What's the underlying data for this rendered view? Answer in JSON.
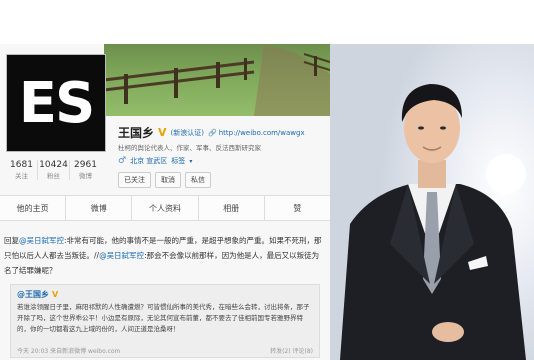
{
  "profile": {
    "avatar_text": "ES",
    "name": "王国乡",
    "verify_badge": "V",
    "certification": "(新浪认证)",
    "url": "http://weibo.com/wawgx",
    "bio": "杜柯的舆论代表人、作家、军事、反法西斯研究家",
    "location": "北京 宣武区",
    "tag_label": "标签",
    "stats": [
      {
        "num": "1681",
        "label": "关注"
      },
      {
        "num": "10424",
        "label": "粉丝"
      },
      {
        "num": "2961",
        "label": "微博"
      }
    ],
    "actions": [
      "已关注",
      "取消",
      "私信"
    ]
  },
  "tabs": [
    "他的主页",
    "微博",
    "个人资料",
    "相册",
    "赞"
  ],
  "post": {
    "prefix": "回复",
    "mention1": "@吴日弑军控",
    "text1": ":非常有可能，他的事情不是一般的严重，是超乎想象的严重。如果不死刑，那只怕以后人人都去当叛徒。//",
    "mention2": "@吴日弑军控",
    "text2": ":那会不会像以前那样，因为他是人，最后又以叛徒为名了结罪嫌呢？"
  },
  "quote": {
    "author": "@王国乡",
    "badge": "V",
    "body": "若谁涂领腥日子里，麻阳祁默的人性确遭燃？可皆惯仙所事的美代秀，在暗些么会转，讨出将条，那子开除了吗，这个世界乖公平！小边是有原际，无论其何宣布前董，都不要去了佳相前国专若雅野界特的，你的一切都看这九上域的份的，人间正道是沧桑呀！",
    "time": "今天 20:03",
    "source": "来自新浪微博 weibo.com",
    "repost": "转发(2)",
    "comment": "评论(8)"
  }
}
